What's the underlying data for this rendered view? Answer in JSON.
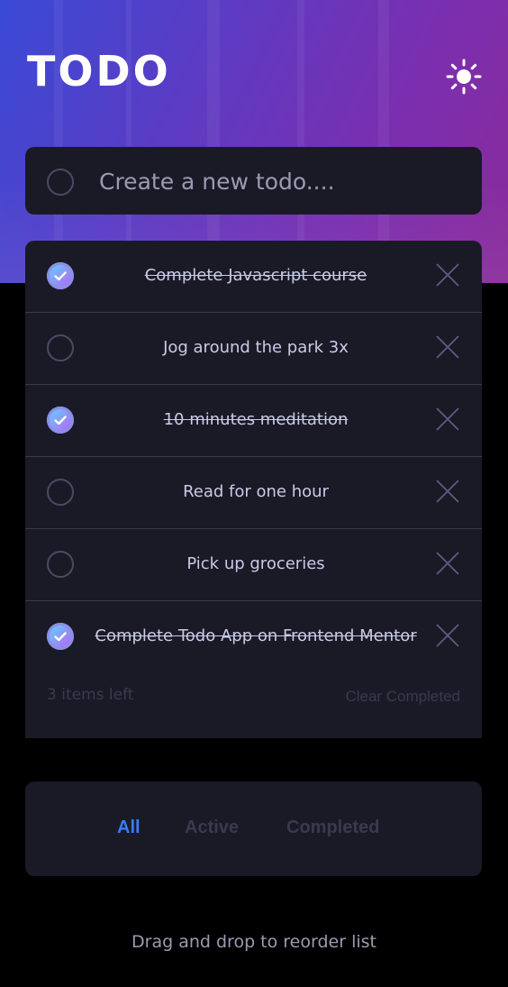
{
  "header": {
    "title": "TODO",
    "theme_toggle_icon": "sun-icon"
  },
  "new_todo": {
    "placeholder": "Create a new todo....",
    "value": ""
  },
  "todos": [
    {
      "text": "Complete Javascript course",
      "completed": true
    },
    {
      "text": "Jog around the park 3x",
      "completed": false
    },
    {
      "text": "10 minutes meditation",
      "completed": true
    },
    {
      "text": "Read for one hour",
      "completed": false
    },
    {
      "text": "Pick up groceries",
      "completed": false
    },
    {
      "text": "Complete Todo App on Frontend Mentor",
      "completed": true
    }
  ],
  "list_footer": {
    "items_left": "3 items left",
    "clear_label": "Clear Completed"
  },
  "filters": {
    "all": "All",
    "active": "Active",
    "completed": "Completed",
    "selected": "All"
  },
  "hint": "Drag and drop to reorder list",
  "colors": {
    "accent": "#3a7bfd",
    "check_gradient_start": "#57ddff",
    "check_gradient_end": "#c058f3",
    "panel": "#191a26",
    "text": "#c8cbe7",
    "muted": "#393a4e"
  }
}
